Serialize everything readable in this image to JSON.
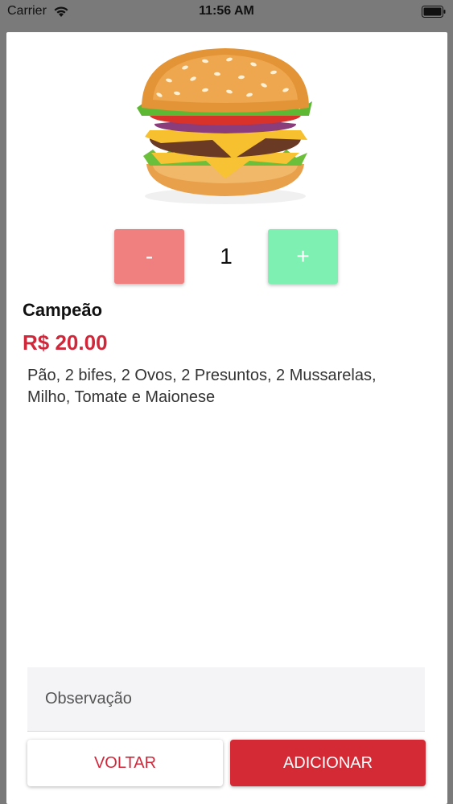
{
  "status_bar": {
    "carrier": "Carrier",
    "time": "11:56 AM",
    "icons": [
      "wifi-icon",
      "battery-icon"
    ]
  },
  "product": {
    "image": "burger-image",
    "name": "Campeão",
    "price": "R$ 20.00",
    "description": "Pão, 2 bifes, 2 Ovos, 2 Presuntos, 2 Mussarelas, Milho, Tomate e Maionese"
  },
  "quantity": {
    "minus_label": "-",
    "value": "1",
    "plus_label": "+"
  },
  "observation": {
    "placeholder": "Observação",
    "value": ""
  },
  "actions": {
    "back_label": "VOLTAR",
    "add_label": "ADICIONAR"
  },
  "colors": {
    "accent": "#d42a36",
    "price": "#d0283a",
    "minus": "#f08080",
    "plus": "#7ef0b2"
  }
}
